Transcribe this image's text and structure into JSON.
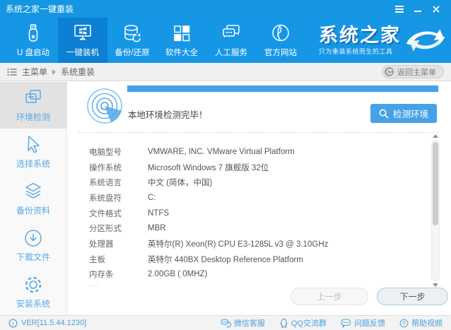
{
  "window": {
    "title": "系统之家一键重装"
  },
  "nav": {
    "items": [
      {
        "label": "U 盘启动",
        "icon": "usb-drive-icon",
        "active": false
      },
      {
        "label": "一键装机",
        "icon": "monitor-windows-icon",
        "active": true
      },
      {
        "label": "备份/还原",
        "icon": "database-restore-icon",
        "active": false
      },
      {
        "label": "软件大全",
        "icon": "software-grid-icon",
        "active": false
      },
      {
        "label": "人工服务",
        "icon": "chat-bubbles-icon",
        "active": false
      },
      {
        "label": "官方网站",
        "icon": "globe-icon",
        "active": false
      }
    ],
    "brand": {
      "name": "系统之家",
      "tagline": "只为重装系统而生的工具"
    }
  },
  "breadcrumb": {
    "root": "主菜单",
    "current": "系统重装",
    "back_label": "返回主菜单"
  },
  "sidebar": {
    "items": [
      {
        "label": "环境检测",
        "icon": "overlap-windows-icon",
        "active": true
      },
      {
        "label": "选择系统",
        "icon": "cursor-icon",
        "active": false
      },
      {
        "label": "备份资料",
        "icon": "layers-icon",
        "active": false
      },
      {
        "label": "下载文件",
        "icon": "download-circle-icon",
        "active": false
      },
      {
        "label": "安装系统",
        "icon": "gear-icon",
        "active": false
      }
    ]
  },
  "main": {
    "progress_percent": 100,
    "status_text": "本地环境检测完毕！",
    "detect_label": "检测环境",
    "info_rows": [
      {
        "label": "电脑型号",
        "value": "VMWARE, INC. VMware Virtual Platform"
      },
      {
        "label": "操作系统",
        "value": "Microsoft Windows 7 旗舰版  32位"
      },
      {
        "label": "系统语言",
        "value": "中文 (简体，中国)"
      },
      {
        "label": "系统盘符",
        "value": "C:"
      },
      {
        "label": "文件格式",
        "value": "NTFS"
      },
      {
        "label": "分区形式",
        "value": "MBR"
      },
      {
        "label": "处理器",
        "value": "英特尔(R) Xeon(R) CPU E3-1285L v3 @ 3.10GHz"
      },
      {
        "label": "主板",
        "value": "英特尔 440BX Desktop Reference Platform"
      },
      {
        "label": "内存条",
        "value": "2.00GB ( 0MHZ)"
      }
    ],
    "clipped_row_hint": "···",
    "prev_label": "上一步",
    "next_label": "下一步"
  },
  "statusbar": {
    "version": "VER[11.5.44.1230]",
    "links": [
      {
        "label": "微信客服",
        "icon": "wechat-icon"
      },
      {
        "label": "QQ交流群",
        "icon": "qq-icon"
      },
      {
        "label": "问题反馈",
        "icon": "feedback-bubble-icon"
      },
      {
        "label": "帮助视频",
        "icon": "help-circle-icon"
      }
    ]
  },
  "colors": {
    "accent_blue": "#1697E6",
    "nav_active_blue": "#0C80D2",
    "sidebar_link_blue": "#58A9E6",
    "button_blue": "#46A2E8",
    "progress_blue": "#42A0E8",
    "footer_link_blue": "#4BA0DC"
  }
}
